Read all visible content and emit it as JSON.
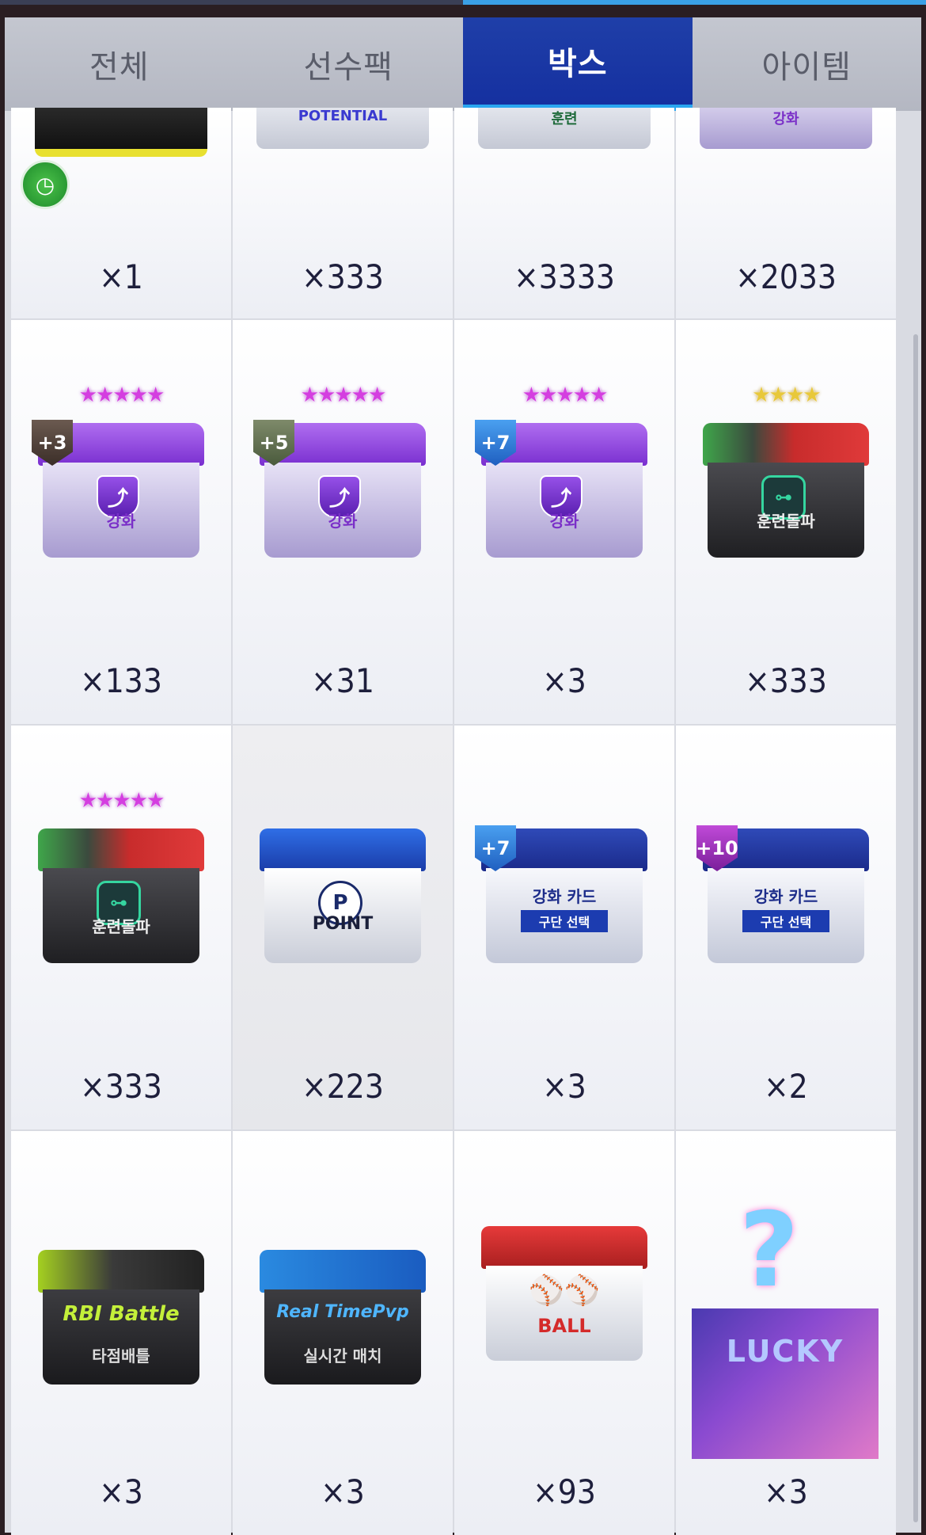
{
  "tabs": [
    {
      "label": "전체",
      "active": false
    },
    {
      "label": "선수팩",
      "active": false
    },
    {
      "label": "박스",
      "active": true
    },
    {
      "label": "아이템",
      "active": false
    }
  ],
  "colors": {
    "active_tab": "#1f3fa8",
    "accent": "#2aa6f0",
    "qty_text": "#1e1f3c"
  },
  "row0": [
    {
      "label": "",
      "qty": "×1",
      "extra": "clock-icon"
    },
    {
      "label": "POTENTIAL",
      "qty": "×333"
    },
    {
      "label": "훈련",
      "qty": "×3333"
    },
    {
      "label": "강화",
      "qty": "×2033"
    }
  ],
  "row1": [
    {
      "badge": "+3",
      "label": "강화",
      "qty": "×133"
    },
    {
      "badge": "+5",
      "label": "강화",
      "qty": "×31"
    },
    {
      "badge": "+7",
      "label": "강화",
      "qty": "×3"
    },
    {
      "label": "훈련돌파",
      "qty": "×333"
    }
  ],
  "row2": [
    {
      "label": "훈련돌파",
      "qty": "×333"
    },
    {
      "label": "POINT",
      "emblem": "P",
      "qty": "×223"
    },
    {
      "badge": "+7",
      "card_title": "강화 카드",
      "card_sub": "구단 선택",
      "qty": "×3"
    },
    {
      "badge": "+10",
      "card_title": "강화 카드",
      "card_sub": "구단 선택",
      "qty": "×2"
    }
  ],
  "row3": [
    {
      "script": "RBI Battle",
      "label": "타점배틀",
      "qty": "×3"
    },
    {
      "script": "Real TimePvp",
      "label": "실시간 매치",
      "qty": "×3"
    },
    {
      "label": "BALL",
      "qty": "×93"
    },
    {
      "label": "LUCKY",
      "qty": "×3"
    }
  ]
}
